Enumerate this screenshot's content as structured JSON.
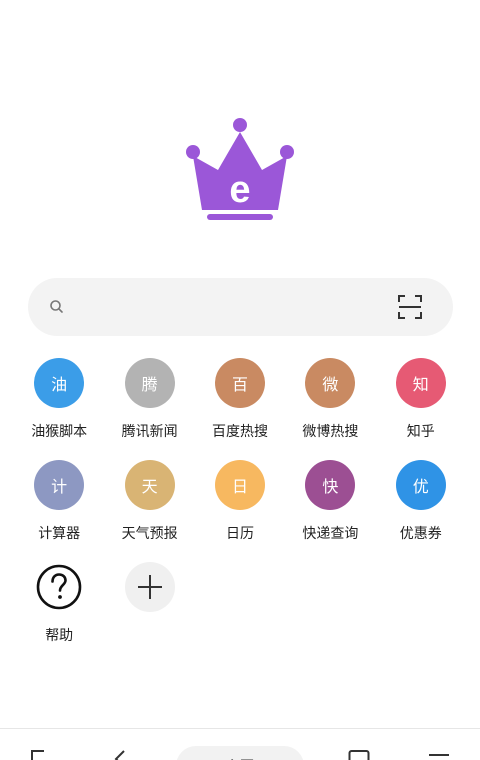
{
  "logo": {
    "icon": "crown-e-logo",
    "letter": "e",
    "color": "#9b57d8"
  },
  "search": {
    "placeholder": "",
    "icon": "search-icon",
    "scan_icon": "scan-icon"
  },
  "shortcuts": [
    {
      "glyph": "油",
      "label": "油猴脚本",
      "color": "#3b9de8"
    },
    {
      "glyph": "腾",
      "label": "腾讯新闻",
      "color": "#b3b3b3"
    },
    {
      "glyph": "百",
      "label": "百度热搜",
      "color": "#c98a62"
    },
    {
      "glyph": "微",
      "label": "微博热搜",
      "color": "#c98a62"
    },
    {
      "glyph": "知",
      "label": "知乎",
      "color": "#e65a74"
    },
    {
      "glyph": "计",
      "label": "计算器",
      "color": "#8d98c2"
    },
    {
      "glyph": "天",
      "label": "天气预报",
      "color": "#d9b474"
    },
    {
      "glyph": "日",
      "label": "日历",
      "color": "#f7b860"
    },
    {
      "glyph": "快",
      "label": "快递查询",
      "color": "#9c4f93"
    },
    {
      "glyph": "优",
      "label": "优惠券",
      "color": "#2f93e6"
    }
  ],
  "help": {
    "label": "帮助",
    "icon": "help-icon"
  },
  "add": {
    "icon": "plus-icon"
  },
  "bottom_bar": {
    "home_label": "主页"
  }
}
